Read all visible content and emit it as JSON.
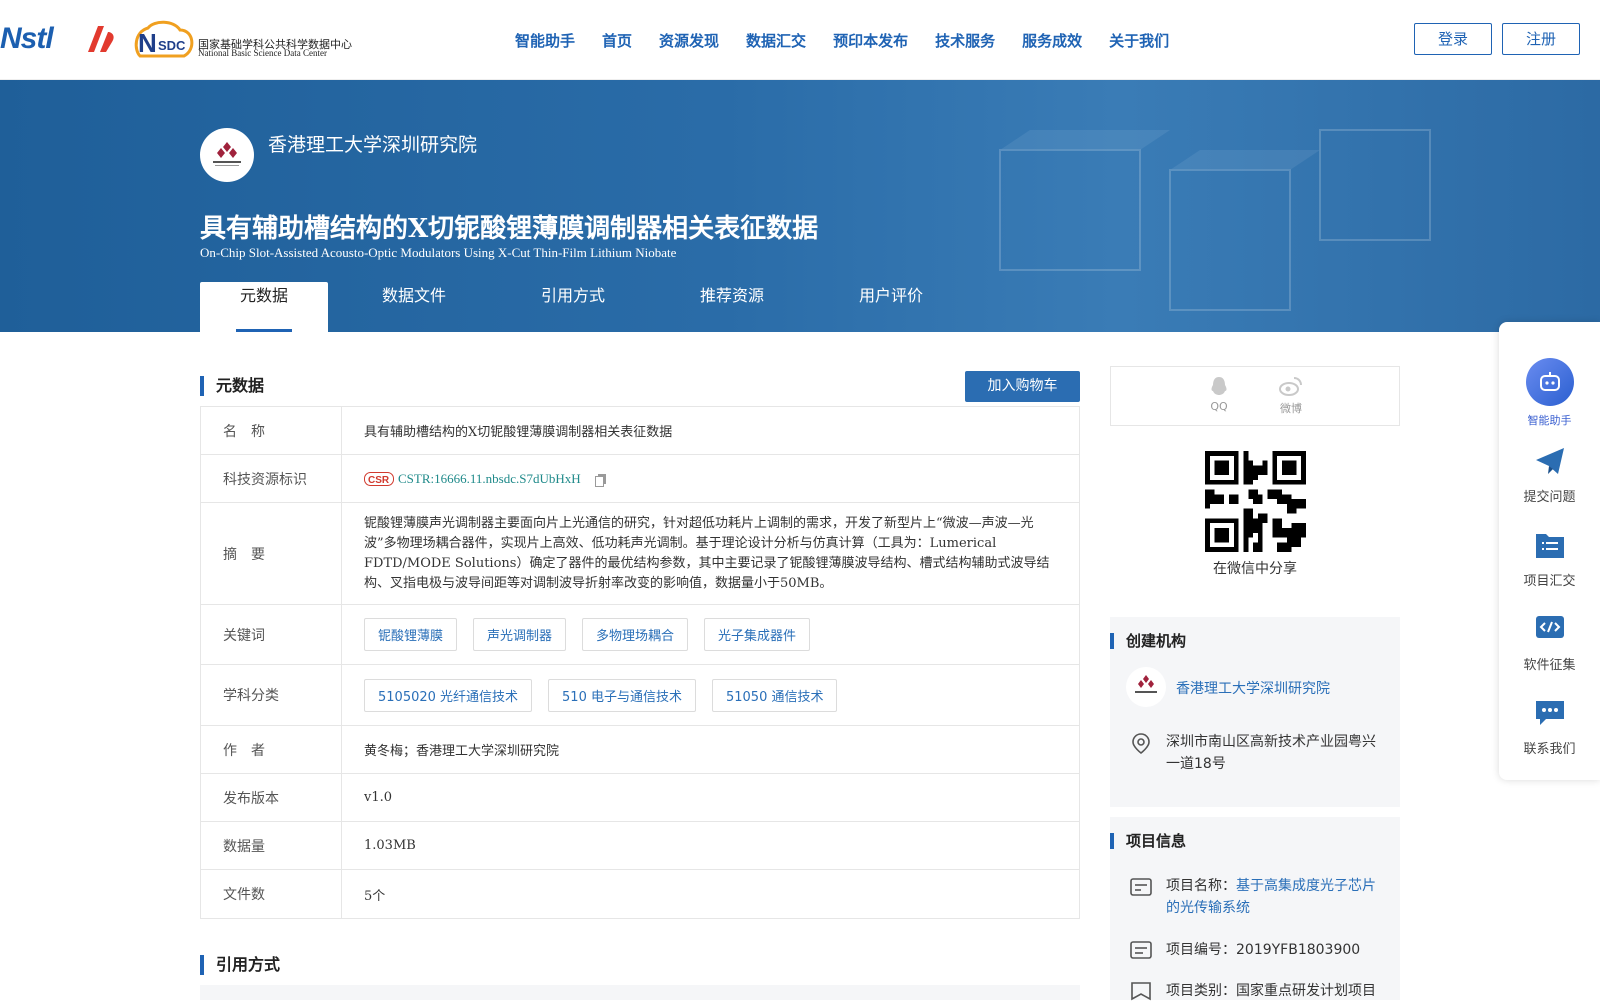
{
  "header": {
    "logos": {
      "nstl": "Nstl",
      "nsdc_cn": "国家基础学科公共科学数据中心",
      "nsdc_en": "National Basic Science Data Center",
      "nsdc_abbr": "SDC"
    },
    "nav": [
      "智能助手",
      "首页",
      "资源发现",
      "数据汇交",
      "预印本发布",
      "技术服务",
      "服务成效",
      "关于我们"
    ],
    "login": "登录",
    "register": "注册"
  },
  "hero": {
    "org_name": "香港理工大学深圳研究院",
    "title_cn": "具有辅助槽结构的X切铌酸锂薄膜调制器相关表征数据",
    "title_en": "On-Chip Slot-Assisted Acousto-Optic Modulators Using X-Cut Thin-Film Lithium Niobate",
    "tabs": [
      "元数据",
      "数据文件",
      "引用方式",
      "推荐资源",
      "用户评价"
    ]
  },
  "metadata": {
    "section_title": "元数据",
    "cart_button": "加入购物车",
    "rows": {
      "name": {
        "key": "名　称",
        "value": "具有辅助槽结构的X切铌酸锂薄膜调制器相关表征数据"
      },
      "cstr": {
        "key": "科技资源标识",
        "value": "CSTR:16666.11.nbsdc.S7dUbHxH",
        "badge": "CSR"
      },
      "abstract": {
        "key": "摘　要",
        "value": "铌酸锂薄膜声光调制器主要面向片上光通信的研究，针对超低功耗片上调制的需求，开发了新型片上“微波—声波—光波”多物理场耦合器件，实现片上高效、低功耗声光调制。基于理论设计分析与仿真计算（工具为：Lumerical FDTD/MODE Solutions）确定了器件的最优结构参数，其中主要记录了铌酸锂薄膜波导结构、槽式结构辅助式波导结构、叉指电极与波导间距等对调制波导折射率改变的影响值，数据量小于50MB。"
      },
      "keywords": {
        "key": "关键词",
        "tags": [
          "铌酸锂薄膜",
          "声光调制器",
          "多物理场耦合",
          "光子集成器件"
        ]
      },
      "subjects": {
        "key": "学科分类",
        "tags": [
          "5105020 光纤通信技术",
          "510 电子与通信技术",
          "51050 通信技术"
        ]
      },
      "author": {
        "key": "作　者",
        "value": "黄冬梅；香港理工大学深圳研究院"
      },
      "version": {
        "key": "发布版本",
        "value": "v1.0"
      },
      "size": {
        "key": "数据量",
        "value": "1.03MB"
      },
      "files": {
        "key": "文件数",
        "value": "5个"
      }
    }
  },
  "citation": {
    "section_title": "引用方式"
  },
  "sidebar": {
    "share": {
      "qq": "QQ",
      "weibo": "微博",
      "wechat": "在微信中分享"
    },
    "creator": {
      "title": "创建机构",
      "org": "香港理工大学深圳研究院",
      "address": "深圳市南山区高新技术产业园粤兴一道18号"
    },
    "project": {
      "title": "项目信息",
      "name_label": "项目名称：",
      "name_value": "基于高集成度光子芯片的光传输系统",
      "code": "项目编号：2019YFB1803900",
      "category": "项目类别：国家重点研发计划项目"
    }
  },
  "float_bar": [
    "智能助手",
    "提交问题",
    "项目汇交",
    "软件征集",
    "联系我们"
  ],
  "colors": {
    "primary": "#1f63b4",
    "hero": "#2a6ca8",
    "teal": "#1f8a8a"
  }
}
